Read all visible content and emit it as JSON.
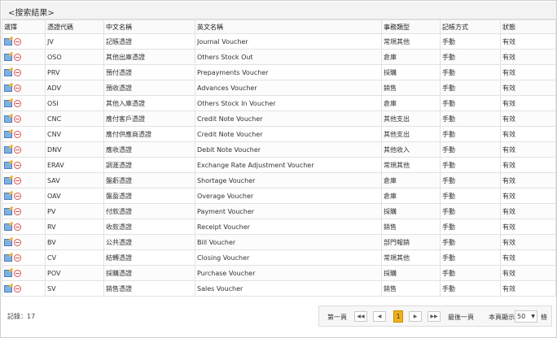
{
  "title": "<搜索結果>",
  "columns": [
    "選擇",
    "憑證代碼",
    "中文名稱",
    "英文名稱",
    "事務類型",
    "記帳方式",
    "狀態"
  ],
  "rows": [
    {
      "code": "JV",
      "cn": "記賬憑證",
      "en": "Journal Voucher",
      "type": "常規其他",
      "mode": "手動",
      "status": "有效"
    },
    {
      "code": "OSO",
      "cn": "其他出庫憑證",
      "en": "Others Stock Out",
      "type": "倉庫",
      "mode": "手動",
      "status": "有效"
    },
    {
      "code": "PRV",
      "cn": "預付憑證",
      "en": "Prepayments Voucher",
      "type": "採購",
      "mode": "手動",
      "status": "有效"
    },
    {
      "code": "ADV",
      "cn": "預收憑證",
      "en": "Advances Voucher",
      "type": "銷售",
      "mode": "手動",
      "status": "有效"
    },
    {
      "code": "OSI",
      "cn": "其他入庫憑證",
      "en": "Others Stock In Voucher",
      "type": "倉庫",
      "mode": "手動",
      "status": "有效"
    },
    {
      "code": "CNC",
      "cn": "應付客戶憑證",
      "en": "Credit Note Voucher",
      "type": "其他支出",
      "mode": "手動",
      "status": "有效"
    },
    {
      "code": "CNV",
      "cn": "應付供應商憑證",
      "en": "Credit Note Voucher",
      "type": "其他支出",
      "mode": "手動",
      "status": "有效"
    },
    {
      "code": "DNV",
      "cn": "應收憑證",
      "en": "Debit Note Voucher",
      "type": "其他收入",
      "mode": "手動",
      "status": "有效"
    },
    {
      "code": "ERAV",
      "cn": "調滙憑證",
      "en": "Exchange Rate Adjustment Voucher",
      "type": "常規其他",
      "mode": "手動",
      "status": "有效"
    },
    {
      "code": "SAV",
      "cn": "盤虧憑證",
      "en": "Shortage Voucher",
      "type": "倉庫",
      "mode": "手動",
      "status": "有效"
    },
    {
      "code": "OAV",
      "cn": "盤盈憑證",
      "en": "Overage Voucher",
      "type": "倉庫",
      "mode": "手動",
      "status": "有效"
    },
    {
      "code": "PV",
      "cn": "付款憑證",
      "en": "Payment Voucher",
      "type": "採購",
      "mode": "手動",
      "status": "有效"
    },
    {
      "code": "RV",
      "cn": "收款憑證",
      "en": "Receipt Voucher",
      "type": "銷售",
      "mode": "手動",
      "status": "有效"
    },
    {
      "code": "BV",
      "cn": "公共憑證",
      "en": "Bill Voucher",
      "type": "部門報銷",
      "mode": "手動",
      "status": "有效"
    },
    {
      "code": "CV",
      "cn": "結轉憑證",
      "en": "Closing Voucher",
      "type": "常規其他",
      "mode": "手動",
      "status": "有效"
    },
    {
      "code": "POV",
      "cn": "採購憑證",
      "en": "Purchase Voucher",
      "type": "採購",
      "mode": "手動",
      "status": "有效"
    },
    {
      "code": "SV",
      "cn": "銷售憑證",
      "en": "Sales Voucher",
      "type": "銷售",
      "mode": "手動",
      "status": "有效"
    }
  ],
  "footer": {
    "record_count": "記錄：17"
  },
  "pager": {
    "first_label": "第一頁",
    "last_label": "最後一頁",
    "per_page_label": "本頁顯示:",
    "per_page_value": "50",
    "unit_label": "條",
    "current_page": "1",
    "btn_first": "◀◀",
    "btn_prev": "◀",
    "btn_next": "▶",
    "btn_last": "▶▶"
  },
  "icons": {
    "edit": "edit-icon",
    "delete": "delete-icon"
  }
}
